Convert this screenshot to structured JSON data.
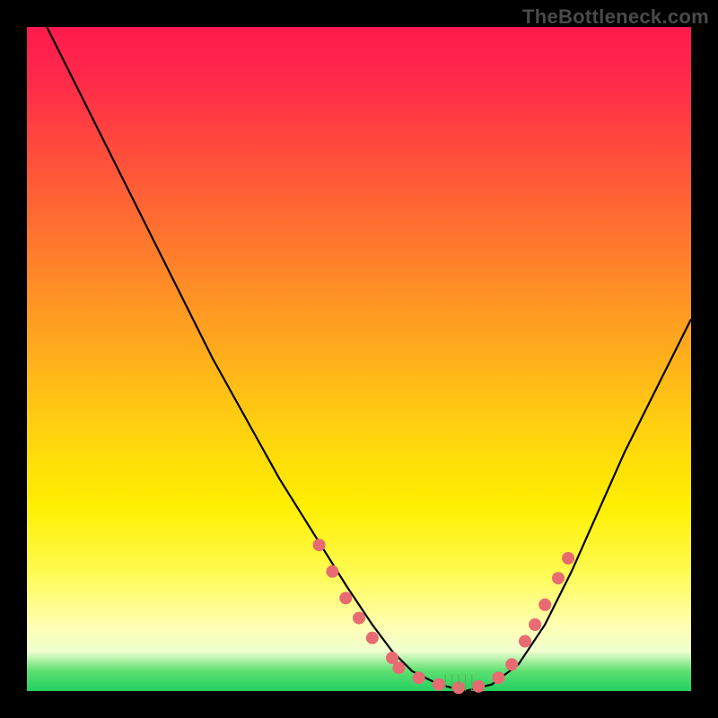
{
  "watermark": "TheBottleneck.com",
  "chart_data": {
    "type": "line",
    "title": "",
    "xlabel": "",
    "ylabel": "",
    "xlim": [
      0,
      100
    ],
    "ylim": [
      0,
      100
    ],
    "curve": {
      "name": "bottleneck-curve",
      "x": [
        3,
        8,
        13,
        18,
        23,
        28,
        33,
        38,
        43,
        48,
        52,
        55,
        58,
        62,
        66,
        70,
        74,
        78,
        82,
        86,
        90,
        94,
        98,
        100
      ],
      "y": [
        100,
        90,
        80,
        70,
        60,
        50,
        41,
        32,
        24,
        16,
        10,
        6,
        3,
        1,
        0,
        1,
        4,
        10,
        18,
        27,
        36,
        44,
        52,
        56
      ]
    },
    "markers": {
      "name": "highlight-dots",
      "color": "#e86b72",
      "points": [
        {
          "x": 44,
          "y": 22
        },
        {
          "x": 46,
          "y": 18
        },
        {
          "x": 48,
          "y": 14
        },
        {
          "x": 50,
          "y": 11
        },
        {
          "x": 52,
          "y": 8
        },
        {
          "x": 55,
          "y": 5
        },
        {
          "x": 56,
          "y": 3.5
        },
        {
          "x": 59,
          "y": 2
        },
        {
          "x": 62,
          "y": 1
        },
        {
          "x": 65,
          "y": 0.5
        },
        {
          "x": 68,
          "y": 0.7
        },
        {
          "x": 71,
          "y": 2
        },
        {
          "x": 73,
          "y": 4
        },
        {
          "x": 75,
          "y": 7.5
        },
        {
          "x": 76.5,
          "y": 10
        },
        {
          "x": 78,
          "y": 13
        },
        {
          "x": 80,
          "y": 17
        },
        {
          "x": 81.5,
          "y": 20
        }
      ]
    }
  }
}
